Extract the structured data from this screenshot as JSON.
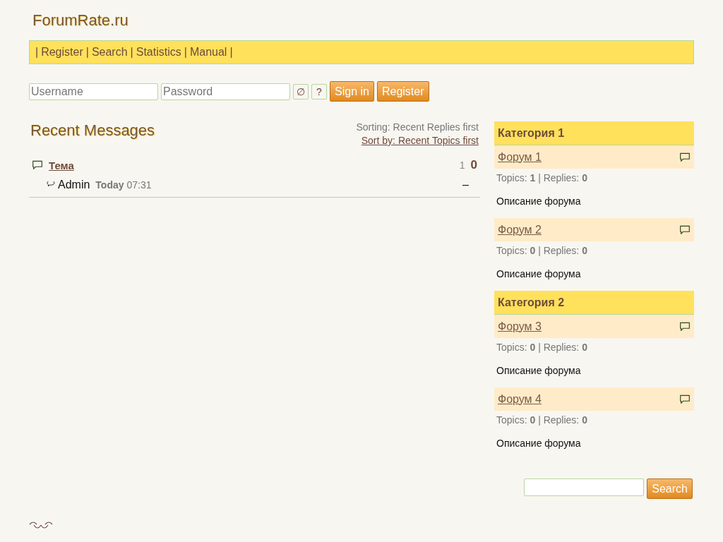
{
  "site_title": "ForumRate.ru",
  "nav": {
    "separator": "|",
    "items": [
      "Register",
      "Search",
      "Statistics",
      "Manual"
    ]
  },
  "login": {
    "username_placeholder": "Username",
    "password_placeholder": "Password",
    "clear_symbol": "∅",
    "help_symbol": "?",
    "buttons": [
      "Sign in",
      "Register"
    ]
  },
  "recent": {
    "title": "Recent Messages",
    "sorting": "Sorting: Recent Replies first",
    "sort_link": "Sort by: Recent Topics first",
    "topics": [
      {
        "title": "Тема",
        "count_1": "1",
        "count_2": "0",
        "author": "Admin",
        "date": "Today",
        "time": "07:31",
        "last": "–"
      }
    ]
  },
  "categories": [
    {
      "title": "Категория 1",
      "forums": [
        {
          "name": "Форум 1",
          "stats": "Topics: **1** | Replies: **0**",
          "description": "Описание форума"
        },
        {
          "name": "Форум 2",
          "stats": "Topics: **0** | Replies: **0**",
          "description": "Описание форума"
        }
      ]
    },
    {
      "title": "Категория 2",
      "forums": [
        {
          "name": "Форум 3",
          "stats": "Topics: **0** | Replies: **0**",
          "description": "Описание форума"
        },
        {
          "name": "Форум 4",
          "stats": "Topics: **0** | Replies: **0**",
          "description": "Описание форума"
        }
      ]
    }
  ],
  "search": {
    "button": "Search"
  }
}
